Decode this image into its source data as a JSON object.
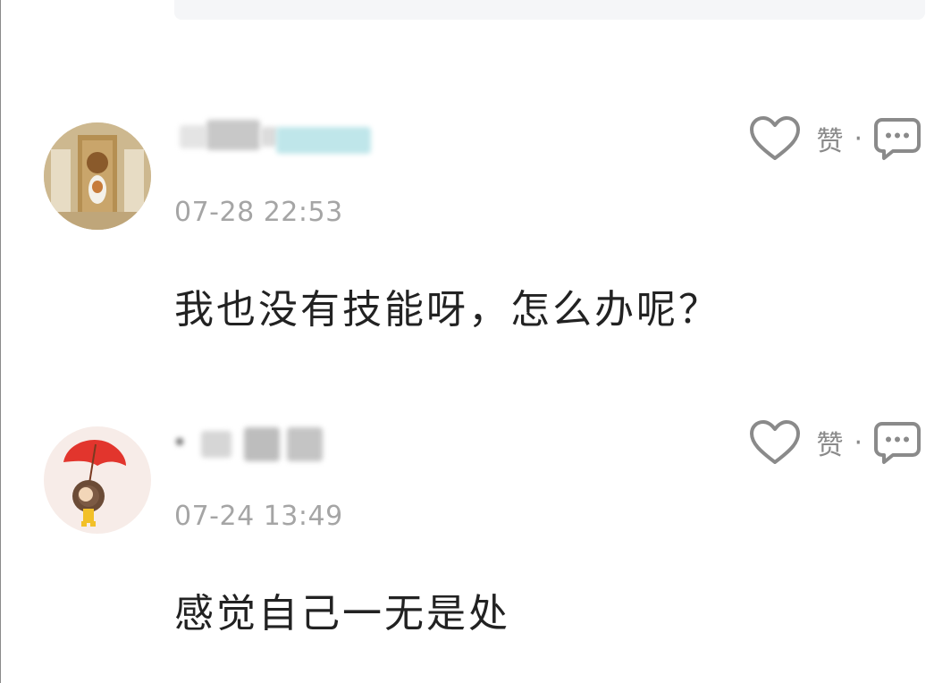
{
  "colors": {
    "text_primary": "#222222",
    "text_muted": "#a5a5a5",
    "icon_gray": "#8a8a8a",
    "reply_box": "#f5f6f8"
  },
  "comments": [
    {
      "avatar_icon": "interior-vase-avatar",
      "username": "",
      "timestamp": "07-28 22:53",
      "text": "我也没有技能呀，怎么办呢？",
      "like_icon": "heart-outline-icon",
      "like_label": "赞",
      "separator": "·",
      "reply_icon": "speech-bubble-icon"
    },
    {
      "avatar_icon": "girl-with-red-umbrella-avatar",
      "username": "",
      "timestamp": "07-24 13:49",
      "text": "感觉自己一无是处",
      "like_icon": "heart-outline-icon",
      "like_label": "赞",
      "separator": "·",
      "reply_icon": "speech-bubble-icon"
    }
  ]
}
